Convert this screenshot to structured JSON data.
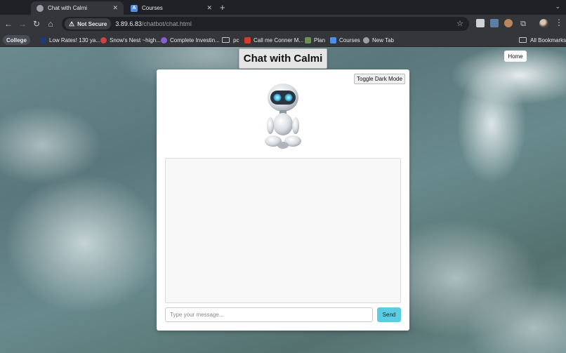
{
  "browser": {
    "tabs": [
      {
        "title": "Chat with Calmi",
        "active": true
      },
      {
        "title": "Courses",
        "active": false
      }
    ],
    "security_label": "Not Secure",
    "url_host": "3.89.6.83",
    "url_path": "/chatbot/chat.html",
    "bookmarks": [
      {
        "label": "College"
      },
      {
        "label": "Low Rates! 130 ya..."
      },
      {
        "label": "Snow's Nest ~high..."
      },
      {
        "label": "Complete Investin..."
      },
      {
        "label": "pc"
      },
      {
        "label": "Call me Conner M..."
      },
      {
        "label": "Plan"
      },
      {
        "label": "Courses"
      },
      {
        "label": "New Tab"
      }
    ],
    "all_bookmarks_label": "All Bookmarks"
  },
  "page": {
    "title": "Chat with Calmi",
    "home_label": "Home",
    "toggle_dark_label": "Toggle Dark Mode",
    "message_placeholder": "Type your message...",
    "send_label": "Send"
  },
  "colors": {
    "send_button": "#5bcde3",
    "card_bg": "#ffffff"
  },
  "icons": {
    "back": "arrow-left",
    "forward": "arrow-right",
    "reload": "reload",
    "home": "house",
    "warning": "warning-triangle",
    "star": "star",
    "extensions": "puzzle",
    "menu": "vertical-dots",
    "folder": "folder"
  }
}
